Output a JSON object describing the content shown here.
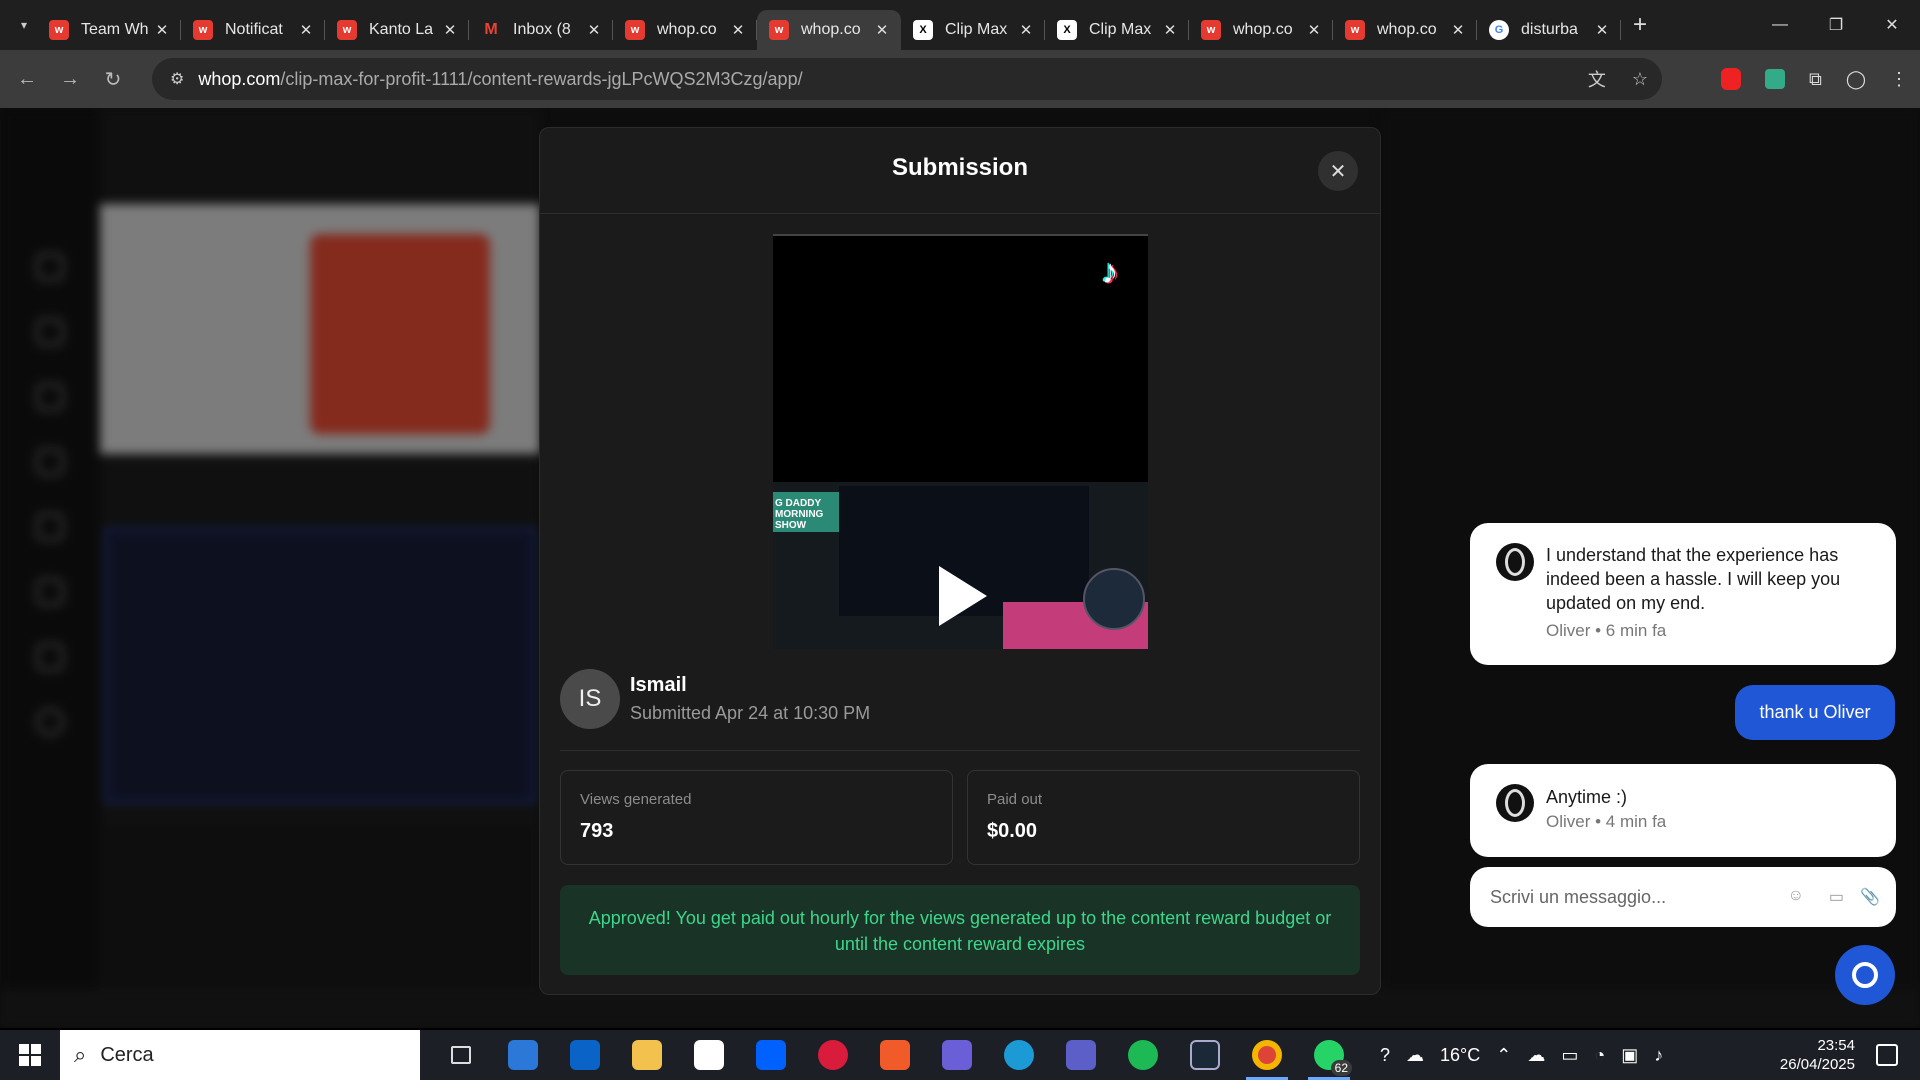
{
  "browser": {
    "tabs": [
      {
        "title": "Team Wh",
        "icon": "whop-icon"
      },
      {
        "title": "Notificat",
        "icon": "whop-icon"
      },
      {
        "title": "Kanto La",
        "icon": "whop-icon"
      },
      {
        "title": "Inbox (8",
        "icon": "gmail-icon"
      },
      {
        "title": "whop.co",
        "icon": "whop-icon"
      },
      {
        "title": "whop.co",
        "icon": "whop-icon",
        "active": true
      },
      {
        "title": "Clip Max",
        "icon": "x-icon"
      },
      {
        "title": "Clip Max",
        "icon": "x-icon"
      },
      {
        "title": "whop.co",
        "icon": "whop-icon"
      },
      {
        "title": "whop.co",
        "icon": "whop-icon"
      },
      {
        "title": "disturba",
        "icon": "google-icon"
      }
    ],
    "url_domain": "whop.com",
    "url_path": "/clip-max-for-profit-1111/content-rewards-jgLPcWQS2M3Czg/app/"
  },
  "modal": {
    "title": "Submission",
    "user": {
      "initials": "IS",
      "name": "Ismail",
      "submitted": "Submitted Apr 24 at 10:30 PM"
    },
    "stats": [
      {
        "label": "Views generated",
        "value": "793"
      },
      {
        "label": "Paid out",
        "value": "$0.00"
      }
    ],
    "approved_message": "Approved! You get paid out hourly for the views generated up to the content reward budget or until the content reward expires",
    "video": {
      "banner": "G DADDY MORNING SHOW"
    }
  },
  "chat": {
    "messages": [
      {
        "from": "agent",
        "text": "I understand that the experience has indeed been a hassle. I will keep you updated on my end.",
        "meta": "Oliver • 6 min fa"
      },
      {
        "from": "me",
        "text": "thank u Oliver"
      },
      {
        "from": "agent",
        "text": "Anytime :)",
        "meta": "Oliver • 4 min fa"
      }
    ],
    "input_placeholder": "Scrivi un messaggio..."
  },
  "taskbar": {
    "search_placeholder": "Cerca",
    "whatsapp_badge": "62",
    "weather": "16°C",
    "time": "23:54",
    "date": "26/04/2025"
  },
  "colors": {
    "accent": "#1f57d6",
    "approved_bg": "#193326",
    "approved_text": "#3ed68a",
    "whop_red": "#e43a2f"
  }
}
